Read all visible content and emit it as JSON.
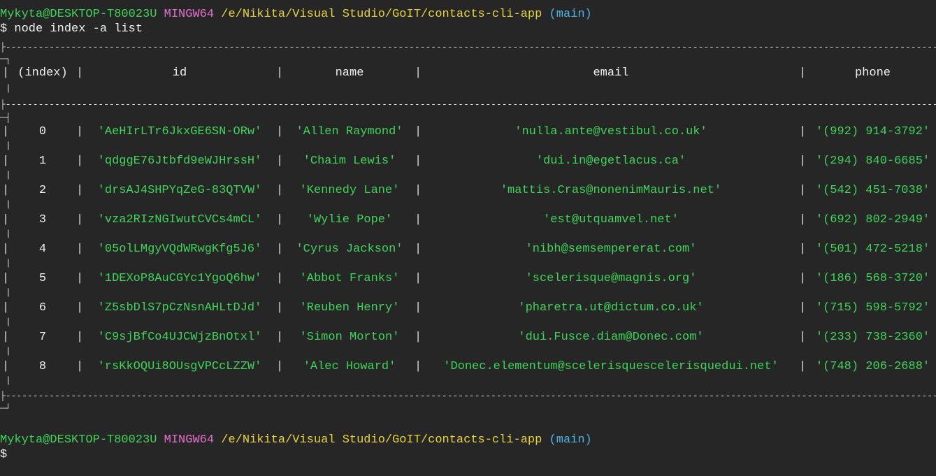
{
  "prompt": {
    "user_host": "Mykyta@DESKTOP-T80023U",
    "shell": "MINGW64",
    "path": "/e/Nikita/Visual Studio/GoIT/contacts-cli-app",
    "branch": "(main)",
    "symbol": "$"
  },
  "command": "node index -a list",
  "table": {
    "columns": [
      "(index)",
      "id",
      "name",
      "email",
      "phone"
    ],
    "rows": [
      {
        "index": "0",
        "id": "'AeHIrLTr6JkxGE6SN-ORw'",
        "name": "'Allen Raymond'",
        "email": "'nulla.ante@vestibul.co.uk'",
        "phone": "'(992) 914-3792'"
      },
      {
        "index": "1",
        "id": "'qdggE76Jtbfd9eWJHrssH'",
        "name": "'Chaim Lewis'",
        "email": "'dui.in@egetlacus.ca'",
        "phone": "'(294) 840-6685'"
      },
      {
        "index": "2",
        "id": "'drsAJ4SHPYqZeG-83QTVW'",
        "name": "'Kennedy Lane'",
        "email": "'mattis.Cras@nonenimMauris.net'",
        "phone": "'(542) 451-7038'"
      },
      {
        "index": "3",
        "id": "'vza2RIzNGIwutCVCs4mCL'",
        "name": "'Wylie Pope'",
        "email": "'est@utquamvel.net'",
        "phone": "'(692) 802-2949'"
      },
      {
        "index": "4",
        "id": "'05olLMgyVQdWRwgKfg5J6'",
        "name": "'Cyrus Jackson'",
        "email": "'nibh@semsempererat.com'",
        "phone": "'(501) 472-5218'"
      },
      {
        "index": "5",
        "id": "'1DEXoP8AuCGYc1YgoQ6hw'",
        "name": "'Abbot Franks'",
        "email": "'scelerisque@magnis.org'",
        "phone": "'(186) 568-3720'"
      },
      {
        "index": "6",
        "id": "'Z5sbDlS7pCzNsnAHLtDJd'",
        "name": "'Reuben Henry'",
        "email": "'pharetra.ut@dictum.co.uk'",
        "phone": "'(715) 598-5792'"
      },
      {
        "index": "7",
        "id": "'C9sjBfCo4UJCWjzBnOtxl'",
        "name": "'Simon Morton'",
        "email": "'dui.Fusce.diam@Donec.com'",
        "phone": "'(233) 738-2360'"
      },
      {
        "index": "8",
        "id": "'rsKkOQUi8OUsgVPCcLZZW'",
        "name": "'Alec Howard'",
        "email": "'Donec.elementum@scelerisquescelerisquedui.net'",
        "phone": "'(748) 206-2688'"
      }
    ]
  },
  "colors": {
    "background": "#262626",
    "user_host": "#3fd45a",
    "shell": "#e870d0",
    "path": "#e8d23e",
    "branch": "#4ab4e8",
    "value": "#3fd45a"
  }
}
